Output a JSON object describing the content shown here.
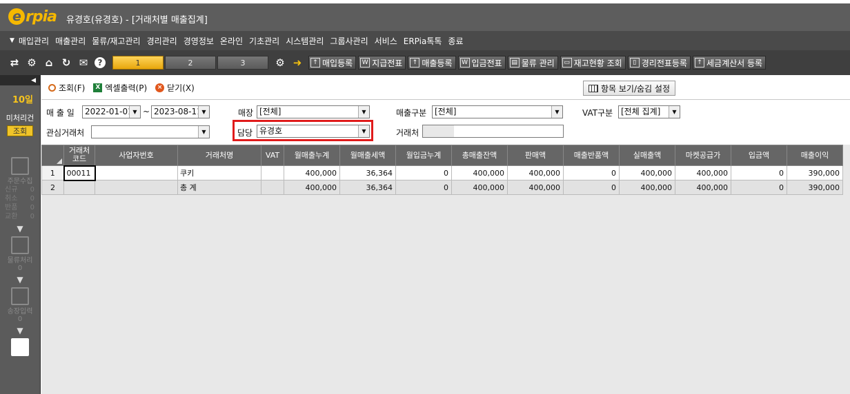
{
  "app": {
    "logo_text": "rpia",
    "logo_letter": "e",
    "window_title": "유경호(유경호) - [거래처별 매출집계]"
  },
  "menu": [
    "매입관리",
    "매출관리",
    "물류/재고관리",
    "경리관리",
    "경영정보",
    "온라인",
    "기초관리",
    "시스템관리",
    "그룹사관리",
    "서비스",
    "ERPia톡톡",
    "종료"
  ],
  "toolbar": {
    "tabs": [
      "1",
      "2",
      "3"
    ],
    "quick_buttons": [
      "매입등록",
      "지급전표",
      "매출등록",
      "입금전표",
      "물류 관리",
      "재고현황 조회",
      "경리전표등록",
      "세금계산서 등록"
    ]
  },
  "sidebar": {
    "day": "10일",
    "pending_label": "미처리건",
    "pending_button": "조회",
    "order_collect": "주문수집",
    "stats": [
      [
        "신규",
        "0"
      ],
      [
        "취소",
        "0"
      ],
      [
        "반품",
        "0"
      ],
      [
        "교환",
        "0"
      ]
    ],
    "logistics": "물류처리",
    "logistics_count": "0",
    "invoice": "송장입력",
    "invoice_count": "0"
  },
  "commands": {
    "search": "조회(F)",
    "excel": "엑셀출력(P)",
    "close": "닫기(X)",
    "column_settings": "항목 보기/숨김 설정"
  },
  "filters": {
    "sales_date_label": "매 출 일",
    "date_from": "2022-01-01",
    "date_to": "2023-08-11",
    "date_sep": "~",
    "store_label": "매장",
    "store_value": "[전체]",
    "sales_type_label": "매출구분",
    "sales_type_value": "[전체]",
    "vat_label": "VAT구분",
    "vat_value": "[전체 집계]",
    "interest_client_label": "관심거래처",
    "interest_client_value": "",
    "manager_label": "담당",
    "manager_value": "유경호",
    "client_label": "거래처",
    "client_value": ""
  },
  "table": {
    "columns": [
      "거래처\n코드",
      "사업자번호",
      "거래처명",
      "VAT",
      "월매출누계",
      "월매출세액",
      "월입금누계",
      "총매출잔액",
      "판매액",
      "매출반품액",
      "실매출액",
      "마켓공급가",
      "입금액",
      "매출이익"
    ],
    "rows": [
      [
        "1",
        "00011",
        "",
        "쿠키",
        "",
        "400,000",
        "36,364",
        "0",
        "400,000",
        "400,000",
        "0",
        "400,000",
        "400,000",
        "0",
        "390,000"
      ],
      [
        "2",
        "",
        "",
        "총 계",
        "",
        "400,000",
        "36,364",
        "0",
        "400,000",
        "400,000",
        "0",
        "400,000",
        "400,000",
        "0",
        "390,000"
      ]
    ]
  }
}
